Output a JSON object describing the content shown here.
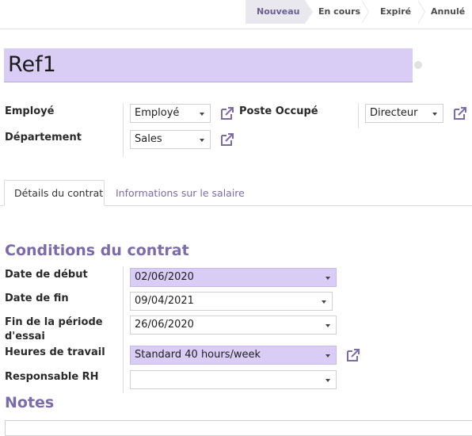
{
  "status_bar": {
    "stages": [
      "Nouveau",
      "En cours",
      "Expiré",
      "Annulé"
    ],
    "active": "Nouveau"
  },
  "contract": {
    "name": "Ref1"
  },
  "header_fields": {
    "employee": {
      "label": "Employé",
      "value": "Employé"
    },
    "department": {
      "label": "Département",
      "value": "Sales"
    },
    "job": {
      "label": "Poste Occupé",
      "value": "Directeur"
    }
  },
  "tabs": [
    {
      "label": "Détails du contrat",
      "active": true
    },
    {
      "label": "Informations sur le salaire",
      "active": false
    }
  ],
  "conditions": {
    "title": "Conditions du contrat",
    "start_date": {
      "label": "Date de début",
      "value": "02/06/2020"
    },
    "end_date": {
      "label": "Date de fin",
      "value": "09/04/2021"
    },
    "trial_end": {
      "label_line1": "Fin de la période",
      "label_line2": "d'essai",
      "value": "26/06/2020"
    },
    "working_hours": {
      "label": "Heures de travail",
      "value": "Standard 40 hours/week"
    },
    "hr_responsible": {
      "label": "Responsable RH",
      "value": ""
    }
  },
  "notes": {
    "title": "Notes"
  },
  "colors": {
    "accent": "#7c6bab",
    "required_field": "#d9cdf6"
  }
}
